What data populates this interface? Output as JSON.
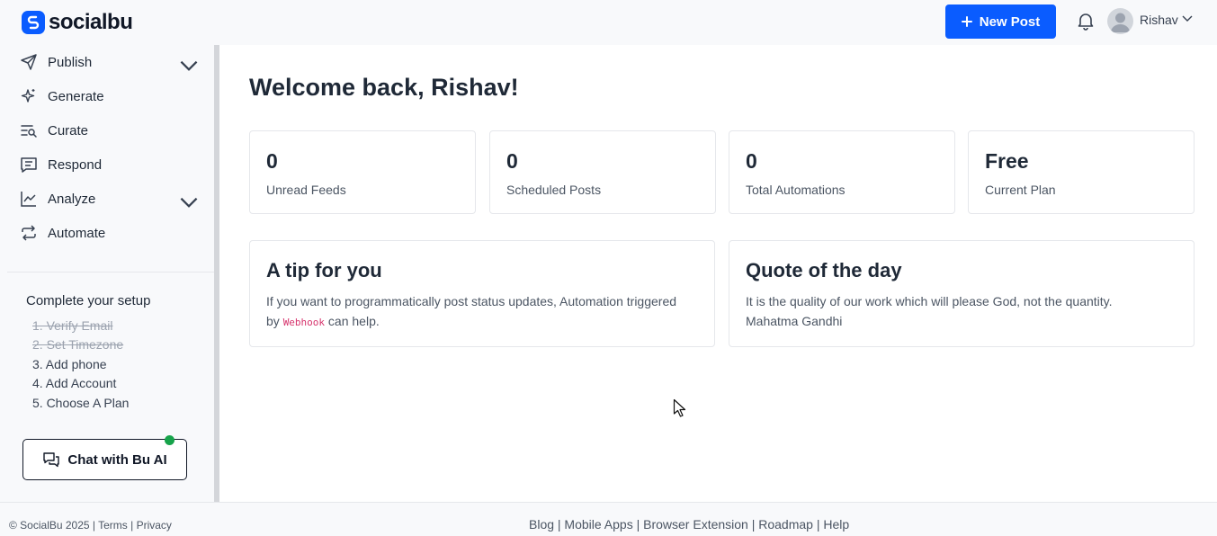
{
  "header": {
    "brand": "socialbu",
    "new_post_label": "New Post",
    "user_name": "Rishav",
    "brand_color": "#0a5cff"
  },
  "sidebar": {
    "items": [
      {
        "label": "Publish",
        "icon": "send-icon",
        "expandable": true
      },
      {
        "label": "Generate",
        "icon": "sparkle-icon",
        "expandable": false
      },
      {
        "label": "Curate",
        "icon": "curate-search-icon",
        "expandable": false
      },
      {
        "label": "Respond",
        "icon": "message-icon",
        "expandable": false
      },
      {
        "label": "Analyze",
        "icon": "chart-line-icon",
        "expandable": true
      },
      {
        "label": "Automate",
        "icon": "repeat-icon",
        "expandable": false
      }
    ],
    "setup": {
      "title": "Complete your setup",
      "steps": [
        {
          "label": "1. Verify Email",
          "done": true
        },
        {
          "label": "2. Set Timezone",
          "done": true
        },
        {
          "label": "3. Add phone",
          "done": false
        },
        {
          "label": "4. Add Account",
          "done": false
        },
        {
          "label": "5. Choose A Plan",
          "done": false
        }
      ]
    },
    "chat_label": "Chat with Bu AI"
  },
  "main": {
    "title": "Welcome back, Rishav!",
    "stats": [
      {
        "value": "0",
        "label": "Unread Feeds"
      },
      {
        "value": "0",
        "label": "Scheduled Posts"
      },
      {
        "value": "0",
        "label": "Total Automations"
      },
      {
        "value": "Free",
        "label": "Current Plan"
      }
    ],
    "tip": {
      "title": "A tip for you",
      "body_before": "If you want to programmatically post status updates, Automation triggered by ",
      "code": "Webhook",
      "body_after": " can help."
    },
    "quote": {
      "title": "Quote of the day",
      "text": "It is the quality of our work which will please God, not the quantity.",
      "author": "Mahatma Gandhi"
    }
  },
  "footer": {
    "left": "© SocialBu 2025 | Terms | Privacy",
    "right": "Blog | Mobile Apps | Browser Extension | Roadmap | Help"
  }
}
